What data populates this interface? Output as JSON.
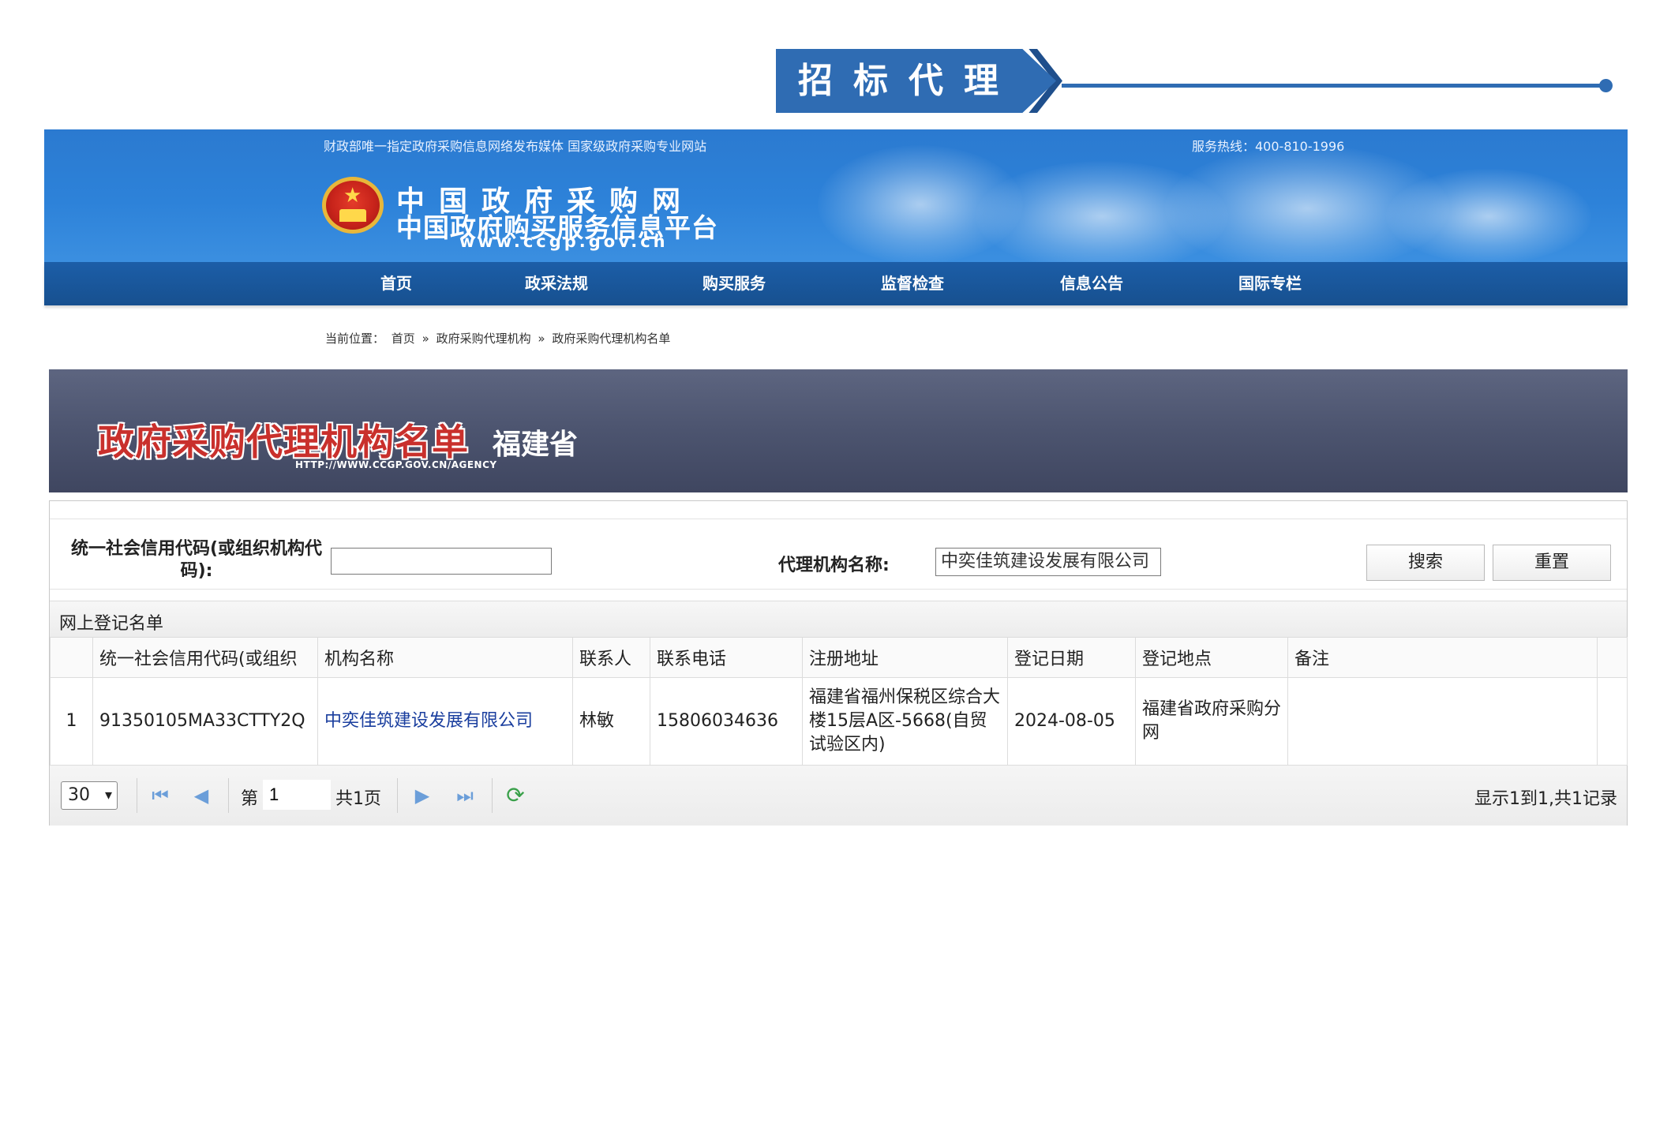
{
  "section": {
    "title": "招标代理"
  },
  "site": {
    "topline": "财政部唯一指定政府采购信息网络发布媒体 国家级政府采购专业网站",
    "hotline": "服务热线：400-810-1996",
    "name_line1": "中国政府采购网",
    "name_line2": "中国政府购买服务信息平台",
    "url": "www.ccgp.gov.cn"
  },
  "nav": [
    "首页",
    "政采法规",
    "购买服务",
    "监督检查",
    "信息公告",
    "国际专栏"
  ],
  "breadcrumb": {
    "prefix": "当前位置：",
    "items": [
      "首页",
      "»",
      "政府采购代理机构",
      "»",
      "政府采购代理机构名单"
    ]
  },
  "list_banner": {
    "title": "政府采购代理机构名单",
    "url": "HTTP://WWW.CCGP.GOV.CN/AGENCY",
    "province": "福建省"
  },
  "search": {
    "credit_label": "统一社会信用代码(或组织机构代码):",
    "credit_value": "",
    "agency_label": "代理机构名称:",
    "agency_value": "中奕佳筑建设发展有限公司",
    "search_button": "搜索",
    "reset_button": "重置"
  },
  "list": {
    "caption": "网上登记名单",
    "columns": [
      "",
      "统一社会信用代码(或组织",
      "机构名称",
      "联系人",
      "联系电话",
      "注册地址",
      "登记日期",
      "登记地点",
      "备注"
    ],
    "rows": [
      {
        "index": "1",
        "credit_code": "91350105MA33CTTY2Q",
        "name": "中奕佳筑建设发展有限公司",
        "contact": "林敏",
        "phone": "15806034636",
        "address": "福建省福州保税区综合大楼15层A区-5668(自贸试验区内)",
        "date": "2024-08-05",
        "place": "福建省政府采购分网",
        "note": ""
      }
    ]
  },
  "pager": {
    "page_size": "30",
    "page_prefix": "第",
    "current_page": "1",
    "total_pages": "共1页",
    "record_info": "显示1到1,共1记录"
  },
  "colors": {
    "banner_blue": "#2f6cb3",
    "header_blue": "#2d82d9",
    "nav_blue": "#1c5ea8",
    "list_banner_bg": "#4c546f",
    "org_link": "#1a3e9e"
  }
}
